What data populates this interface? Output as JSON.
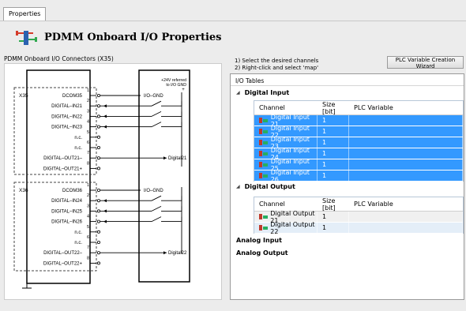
{
  "tab": "Properties",
  "header": {
    "title": "PDMM Onboard I/O Properties"
  },
  "left": {
    "label": "PDMM Onboard I/O Connectors (X35)"
  },
  "diagram": {
    "x35": "X35",
    "x36": "X36",
    "supply": "+24V referred\nto I/O GND",
    "io_gnd": "I/O–GND",
    "digital21": "Digital21",
    "digital22": "Digital22",
    "x35_pins": [
      "DCOM35",
      "DIGITAL–IN21",
      "DIGITAL–IN22",
      "DIGITAL–IN23",
      "n.c.",
      "n.c.",
      "DIGITAL–OUT21–",
      "DIGITAL–OUT21+"
    ],
    "x36_pins": [
      "DCOM36",
      "DIGITAL–IN24",
      "DIGITAL–IN25",
      "DIGITAL–IN26",
      "n.c.",
      "n.c.",
      "DIGITAL–OUT22–",
      "DIGITAL–OUT22+"
    ],
    "pin_numbers": [
      "1",
      "2",
      "3",
      "4",
      "5",
      "6",
      "7",
      "8"
    ]
  },
  "instructions": {
    "line1": "1) Select the desired channels",
    "line2": "2) Right-click and select 'map'"
  },
  "wizard_button": "PLC Variable Creation Wizard",
  "io": {
    "panel_title": "I/O Tables",
    "columns": [
      "Channel",
      "Size [bit]",
      "PLC Variable"
    ],
    "digital_input": {
      "label": "Digital Input",
      "rows": [
        {
          "channel": "Digital Input 21",
          "size": "1",
          "var": ""
        },
        {
          "channel": "Digital Input 22",
          "size": "1",
          "var": ""
        },
        {
          "channel": "Digital Input 23",
          "size": "1",
          "var": ""
        },
        {
          "channel": "Digital Input 24",
          "size": "1",
          "var": ""
        },
        {
          "channel": "Digital Input 25",
          "size": "1",
          "var": ""
        },
        {
          "channel": "Digital Input 26",
          "size": "1",
          "var": ""
        }
      ]
    },
    "digital_output": {
      "label": "Digital Output",
      "rows": [
        {
          "channel": "Digital Output 21",
          "size": "1",
          "var": ""
        },
        {
          "channel": "Digital Output 22",
          "size": "1",
          "var": ""
        }
      ]
    },
    "analog_input": "Analog Input",
    "analog_output": "Analog Output"
  }
}
